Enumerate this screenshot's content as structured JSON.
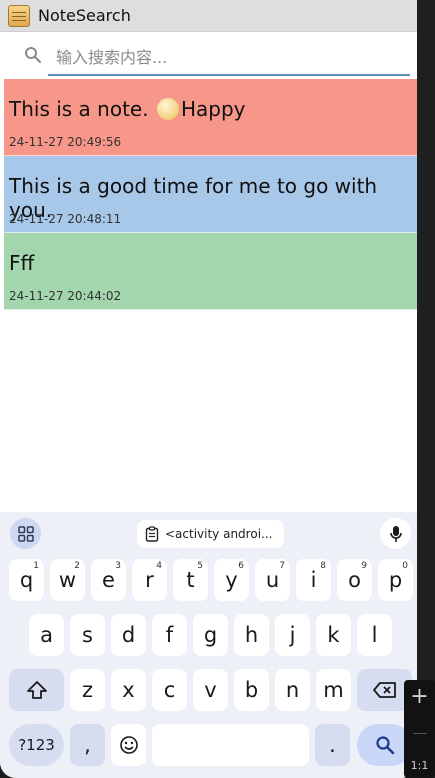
{
  "app": {
    "title": "NoteSearch"
  },
  "search": {
    "placeholder": "输入搜索内容..."
  },
  "notes": [
    {
      "title_before": "This is a note. ",
      "title_after": "Happy",
      "time": "24-11-27 20:49:56",
      "color": "#f6978a"
    },
    {
      "title": "This is a good time for me to go with you.",
      "time": "24-11-27 20:48:11",
      "color": "#a8c8ea"
    },
    {
      "title": "Fff",
      "time": "24-11-27 20:44:02",
      "color": "#a4d6ad"
    }
  ],
  "keyboard": {
    "clipboard": "<activity androi...",
    "row1": [
      "q",
      "w",
      "e",
      "r",
      "t",
      "y",
      "u",
      "i",
      "o",
      "p"
    ],
    "row1_hints": [
      "1",
      "2",
      "3",
      "4",
      "5",
      "6",
      "7",
      "8",
      "9",
      "0"
    ],
    "row2": [
      "a",
      "s",
      "d",
      "f",
      "g",
      "h",
      "j",
      "k",
      "l"
    ],
    "row3": [
      "z",
      "x",
      "c",
      "v",
      "b",
      "n",
      "m"
    ],
    "symbols": "?123",
    "comma": ",",
    "period": "."
  },
  "tools": {
    "ratio": "1:1"
  },
  "colors": {
    "accent": "#5b8fb3",
    "keyboard_bg": "#eef0f7"
  }
}
